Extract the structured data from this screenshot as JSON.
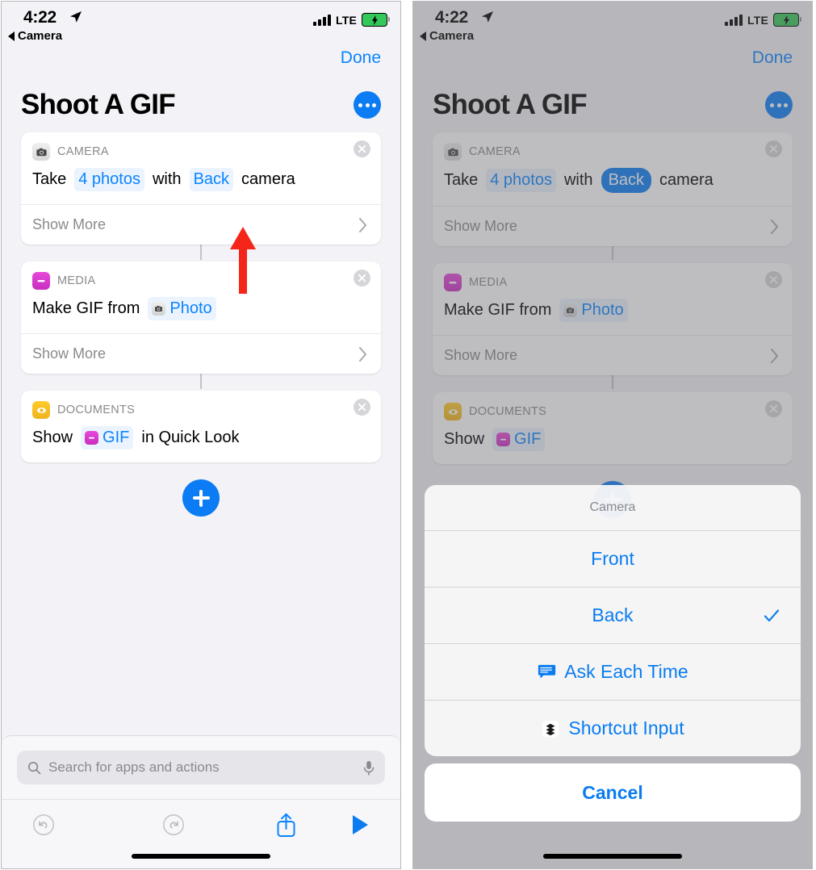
{
  "status_bar": {
    "time": "4:22",
    "back_label": "Camera",
    "carrier": "LTE",
    "location_icon": "location-arrow-icon",
    "signal_icon": "cellular-bars-icon",
    "battery_icon": "battery-charging-icon"
  },
  "nav": {
    "done_label": "Done"
  },
  "header": {
    "title": "Shoot A GIF",
    "more_icon": "ellipsis-icon"
  },
  "actions": [
    {
      "category": "CAMERA",
      "icon": "camera-app-icon",
      "icon_color": "#e0e0e0",
      "text_parts": [
        {
          "type": "text",
          "value": "Take"
        },
        {
          "type": "token",
          "value": "4 photos",
          "style": "light"
        },
        {
          "type": "text",
          "value": "with"
        },
        {
          "type": "token",
          "value": "Back",
          "style": "light",
          "style_right": "solid"
        },
        {
          "type": "text",
          "value": "camera"
        }
      ],
      "show_more_label": "Show More",
      "has_show_more": true
    },
    {
      "category": "MEDIA",
      "icon": "media-app-icon",
      "icon_color": "#d935cb",
      "text_parts": [
        {
          "type": "text",
          "value": "Make GIF from"
        },
        {
          "type": "token",
          "value": "Photo",
          "style": "light",
          "mini_icon": "camera-mini-icon"
        }
      ],
      "show_more_label": "Show More",
      "has_show_more": true
    },
    {
      "category": "DOCUMENTS",
      "icon": "quicklook-eye-icon",
      "icon_color": "#f5bc1f",
      "text_parts": [
        {
          "type": "text",
          "value": "Show"
        },
        {
          "type": "token",
          "value": "GIF",
          "style": "light",
          "mini_icon": "media-mini-icon"
        },
        {
          "type": "text",
          "value": "in Quick Look"
        }
      ],
      "show_more_label": "",
      "has_show_more": false
    }
  ],
  "add_button": {
    "icon": "plus-icon",
    "color": "#0b7cf3"
  },
  "search": {
    "placeholder": "Search for apps and actions",
    "search_icon": "search-icon",
    "mic_icon": "microphone-icon"
  },
  "toolbar": {
    "undo_icon": "undo-icon",
    "redo_icon": "redo-icon",
    "share_icon": "share-icon",
    "play_icon": "play-icon"
  },
  "annotation": {
    "arrow_icon": "red-up-arrow",
    "color": "#f4261a"
  },
  "action_sheet": {
    "title": "Camera",
    "options": [
      {
        "label": "Front",
        "selected": false,
        "icon": null
      },
      {
        "label": "Back",
        "selected": true,
        "icon": "checkmark-icon"
      },
      {
        "label": "Ask Each Time",
        "selected": false,
        "icon": "speech-bubble-icon"
      },
      {
        "label": "Shortcut Input",
        "selected": false,
        "icon": "shortcut-input-icon"
      }
    ],
    "cancel_label": "Cancel"
  },
  "colors": {
    "accent_blue": "#0a84ff",
    "sheet_blue": "#0a7cf0",
    "media_magenta": "#d935cb",
    "documents_yellow": "#f5bc1f",
    "arrow_red": "#f4261a",
    "background": "#f2f2f7"
  }
}
